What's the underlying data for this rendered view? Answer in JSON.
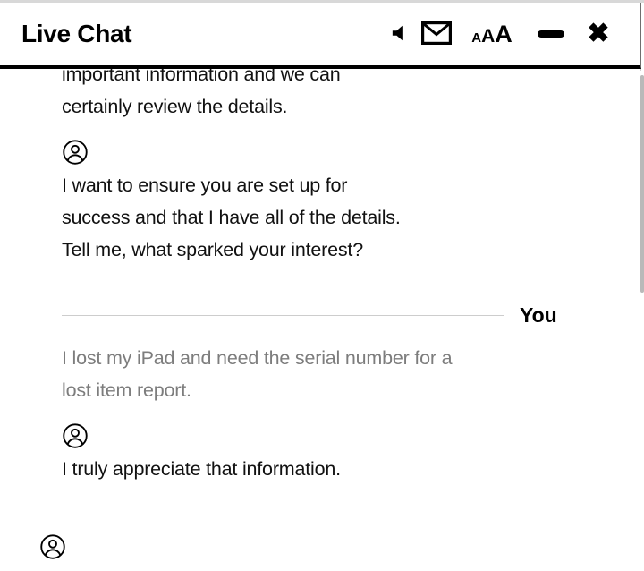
{
  "window": {
    "title": "Live Chat"
  },
  "header": {
    "actions": [
      {
        "name": "sound-toggle",
        "icon": "speaker-muted-icon",
        "label": "Sound"
      },
      {
        "name": "email-transcript",
        "icon": "envelope-icon",
        "label": "Email transcript"
      },
      {
        "name": "font-size",
        "icon": "font-size-icon",
        "label": "AAA",
        "sizes": [
          "A",
          "A",
          "A"
        ]
      },
      {
        "name": "minimize",
        "icon": "minimize-icon",
        "label": "Minimize"
      },
      {
        "name": "close",
        "icon": "close-icon",
        "label": "Close",
        "glyph": "✖"
      }
    ]
  },
  "transcript": {
    "messages": [
      {
        "sender": "agent",
        "avatar": "user-circle-icon",
        "show_avatar": false,
        "clipped": true,
        "text": "important information and we can\ncertainly review the details."
      },
      {
        "sender": "agent",
        "avatar": "user-circle-icon",
        "show_avatar": true,
        "clipped": false,
        "text": "I want to ensure you are set up for\nsuccess and that I have all of the details.\nTell me, what sparked your interest?"
      },
      {
        "sender": "you",
        "avatar": null,
        "show_avatar": false,
        "clipped": false,
        "divider_label": "You",
        "text": "I lost my iPad and need the serial number for a\nlost item report."
      },
      {
        "sender": "agent",
        "avatar": "user-circle-icon",
        "show_avatar": true,
        "clipped": false,
        "text": "I truly appreciate that information."
      }
    ],
    "pending": {
      "avatar": "user-circle-icon"
    },
    "you_divider_label": "You"
  },
  "colors": {
    "agent_text": "#111111",
    "user_text": "#7d7d7d",
    "divider": "#cdcdcd",
    "header_rule": "#000000",
    "scrollbar_thumb": "#b9b9b9"
  },
  "scrollbar": {
    "name": "transcript-scrollbar"
  }
}
